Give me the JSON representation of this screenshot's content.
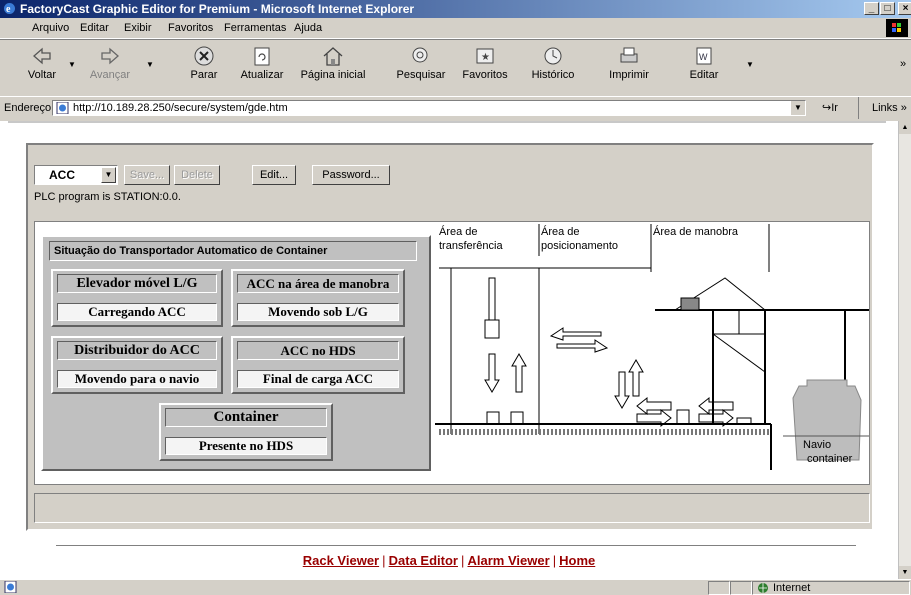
{
  "window": {
    "title": "FactoryCast Graphic Editor for Premium - Microsoft Internet Explorer",
    "minimize_glyph": "_",
    "maximize_glyph": "□",
    "close_glyph": "×"
  },
  "menu": {
    "items": [
      {
        "label": "Arquivo"
      },
      {
        "label": "Editar"
      },
      {
        "label": "Exibir"
      },
      {
        "label": "Favoritos"
      },
      {
        "label": "Ferramentas"
      },
      {
        "label": "Ajuda"
      }
    ]
  },
  "toolbar": {
    "back": "Voltar",
    "forward": "Avançar",
    "stop": "Parar",
    "refresh": "Atualizar",
    "home": "Página inicial",
    "search": "Pesquisar",
    "favorites": "Favoritos",
    "history": "Histórico",
    "print": "Imprimir",
    "edit": "Editar",
    "more": "»"
  },
  "address": {
    "label": "Endereço",
    "url": "http://10.189.28.250/secure/system/gde.htm",
    "go": "Ir",
    "links": "Links",
    "links_more": "»"
  },
  "applet": {
    "combo_value": "ACC",
    "save": "Save...",
    "delete": "Delete",
    "edit": "Edit...",
    "password": "Password...",
    "plc_text": "PLC program is STATION:0.0."
  },
  "panel": {
    "title": "Situação do Transportador Automatico de Container",
    "boxes": [
      {
        "header": "Elevador móvel L/G",
        "value": "Carregando ACC"
      },
      {
        "header": "ACC na área de manobra",
        "value": "Movendo sob L/G"
      },
      {
        "header": "Distribuidor do ACC",
        "value": "Movendo para o navio"
      },
      {
        "header": "ACC no HDS",
        "value": "Final de carga ACC"
      },
      {
        "header": "Container",
        "value": "Presente no HDS"
      }
    ]
  },
  "diagram": {
    "zone1": [
      "Área de",
      "transferência"
    ],
    "zone2": [
      "Área de",
      "posicionamento"
    ],
    "zone3": "Área de manobra",
    "ship": [
      "Navio",
      "container"
    ]
  },
  "footer_links": [
    {
      "label": "Rack Viewer"
    },
    {
      "label": "Data Editor"
    },
    {
      "label": "Alarm Viewer"
    },
    {
      "label": "Home"
    }
  ],
  "footer_sep": "|",
  "status": {
    "zone": "Internet"
  },
  "colors": {
    "link": "#990000",
    "titlebar": "#0a246a",
    "chrome": "#d4d0c8"
  }
}
